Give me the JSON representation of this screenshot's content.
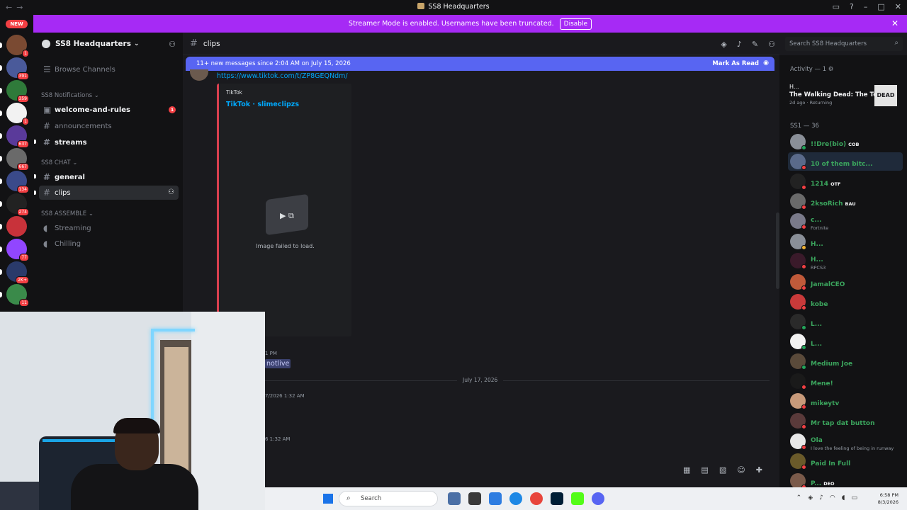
{
  "window": {
    "title": "SS8 Headquarters"
  },
  "banner": {
    "text": "Streamer Mode is enabled. Usernames have been truncated.",
    "disable_label": "Disable"
  },
  "servers": {
    "new_label": "NEW",
    "items": [
      {
        "name": "server-1",
        "count": "1",
        "color": "#7a4a32"
      },
      {
        "name": "server-2",
        "count": "391",
        "color": "#4a5a9a"
      },
      {
        "name": "server-3",
        "count": "359",
        "color": "#2f7a3a"
      },
      {
        "name": "server-4",
        "count": "1",
        "color": "#f2f2f2"
      },
      {
        "name": "server-5",
        "count": "637",
        "color": "#5a3a9a"
      },
      {
        "name": "server-6",
        "count": "667",
        "color": "#6a6a6a"
      },
      {
        "name": "server-7",
        "count": "134",
        "color": "#3a4a8a"
      },
      {
        "name": "server-8",
        "count": "274",
        "color": "#222222"
      },
      {
        "name": "server-9",
        "count": "",
        "color": "#c8323a"
      },
      {
        "name": "server-10",
        "count": "77",
        "color": "#9146ff"
      },
      {
        "name": "server-11",
        "count": "2K+",
        "color": "#2a3a6a"
      },
      {
        "name": "server-12",
        "count": "11",
        "color": "#3a8a4a"
      }
    ]
  },
  "guild": {
    "name": "SS8 Headquarters"
  },
  "sidebar": {
    "browse": "Browse Channels",
    "cat1": "SS8 Notifications",
    "welcome": "welcome-and-rules",
    "welcome_badge": "1",
    "announcements": "announcements",
    "streams": "streams",
    "cat2": "SS8 CHAT",
    "general": "general",
    "clips": "clips",
    "cat3": "SS8 ASSEMBLE",
    "voice1": "Streaming",
    "voice2": "Chilling"
  },
  "chat": {
    "channel": "clips",
    "search_placeholder": "Search SS8 Headquarters",
    "new_messages": "11+ new messages since 2:04 AM on July 15, 2026",
    "mark_as_read": "Mark As Read",
    "link": "https://www.tiktok.com/t/ZP8GEQNdm/",
    "embed_provider": "TikTok",
    "embed_title": "TikTok · slimeclipzs",
    "image_failed": "Image failed to load.",
    "time1": "1 PM",
    "mention": "notlive",
    "date_divider": "July 17, 2026",
    "time2": "7/2026 1:32 AM",
    "time3": "6 1:32 AM"
  },
  "members": {
    "activity_header": "Activity — 1",
    "activity_user": "H...",
    "activity_game": "The Walking Dead: The Tell...",
    "activity_meta": "2d ago · Returning",
    "activity_cover": "DEAD",
    "role_header": "SS1 — 36",
    "list": [
      {
        "name": "!!Dre(bio)",
        "tag": "COB",
        "sub": "",
        "color": "#8a8f98",
        "status": "#23a55a"
      },
      {
        "name": "10 of them bitc...",
        "tag": "",
        "sub": "",
        "color": "#5a6a8a",
        "status": "#f23f43"
      },
      {
        "name": "1214",
        "tag": "OTF",
        "sub": "",
        "color": "#222",
        "status": "#f23f43"
      },
      {
        "name": "2ksoRich",
        "tag": "BAU",
        "sub": "",
        "color": "#6a6a6a",
        "status": "#f23f43"
      },
      {
        "name": "c...",
        "tag": "",
        "sub": "Fortnite",
        "color": "#7a7a8a",
        "status": "#f23f43"
      },
      {
        "name": "H...",
        "tag": "",
        "sub": "",
        "color": "#8a8f98",
        "status": "#f0b232"
      },
      {
        "name": "H...",
        "tag": "",
        "sub": "RPCS3",
        "color": "#3a1a2a",
        "status": "#f23f43"
      },
      {
        "name": "JamalCEO",
        "tag": "",
        "sub": "",
        "color": "#c05a3a",
        "status": "#f23f43"
      },
      {
        "name": "kobe",
        "tag": "",
        "sub": "",
        "color": "#c83a3a",
        "status": "#f23f43"
      },
      {
        "name": "L...",
        "tag": "",
        "sub": "",
        "color": "#2a2a2a",
        "status": "#23a55a"
      },
      {
        "name": "L...",
        "tag": "",
        "sub": "",
        "color": "#f2f2f2",
        "status": "#23a55a"
      },
      {
        "name": "Medium Joe",
        "tag": "",
        "sub": "",
        "color": "#5a4a3a",
        "status": "#23a55a"
      },
      {
        "name": "Mene!",
        "tag": "",
        "sub": "",
        "color": "#1a1a1a",
        "status": "#f23f43"
      },
      {
        "name": "mikeytv",
        "tag": "",
        "sub": "",
        "color": "#c89a7a",
        "status": "#f23f43"
      },
      {
        "name": "Mr tap dat button",
        "tag": "",
        "sub": "",
        "color": "#5a3a3a",
        "status": "#f23f43"
      },
      {
        "name": "Ola",
        "tag": "",
        "sub": "I love the feeling of being in runway",
        "color": "#e8e8e8",
        "status": "#f23f43"
      },
      {
        "name": "Paid In Full",
        "tag": "",
        "sub": "",
        "color": "#6a5a2a",
        "status": "#f23f43"
      },
      {
        "name": "P...",
        "tag": "DEO",
        "sub": "",
        "color": "#7a5a4a",
        "status": "#f23f43"
      }
    ]
  },
  "taskbar": {
    "search": "Search",
    "time": "6:58 PM",
    "date": "8/3/2026"
  }
}
